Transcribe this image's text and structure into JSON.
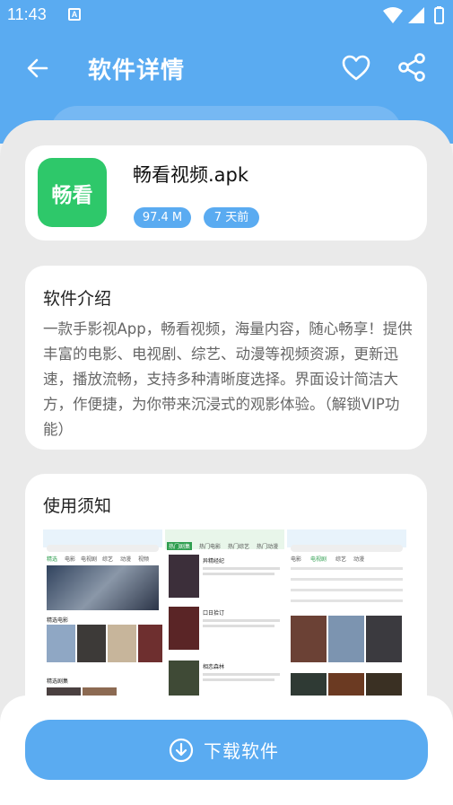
{
  "status_bar": {
    "time": "11:43",
    "notification_letter": "A"
  },
  "app_bar": {
    "title": "软件详情",
    "back_icon": "arrow-back-icon",
    "favorite_icon": "heart-outline-icon",
    "share_icon": "share-icon"
  },
  "app": {
    "icon_text": "畅看",
    "name": "畅看视频.apk",
    "size": "97.4 M",
    "updated": "7 天前"
  },
  "intro": {
    "title": "软件介绍",
    "text": "一款手影视App，畅看视频，海量内容，随心畅享！提供丰富的电影、电视剧、综艺、动漫等视频资源，更新迅速，播放流畅，支持多种清晰度选择。界面设计简洁大方，作便捷，为你带来沉浸式的观影体验。（解锁VIP功能）"
  },
  "notice": {
    "title": "使用须知",
    "screenshots": [
      {
        "tabs": [
          "精选",
          "电影",
          "电视剧",
          "综艺",
          "动漫",
          "视频"
        ],
        "section1": "精选电影",
        "section2": "精选剧集"
      },
      {
        "tabs": [
          "热门剧集",
          "热门电影",
          "热门综艺",
          "热门动漫"
        ],
        "items": [
          "异精经纪",
          "口日拾订",
          "相恋森林"
        ]
      },
      {
        "tabs": [
          "电影",
          "电视剧",
          "综艺",
          "动漫"
        ]
      }
    ]
  },
  "download": {
    "label": "下载软件",
    "icon": "download-icon"
  },
  "colors": {
    "primary": "#5aabf1",
    "app_icon": "#2ec86a",
    "sheet": "#eaeaea"
  }
}
